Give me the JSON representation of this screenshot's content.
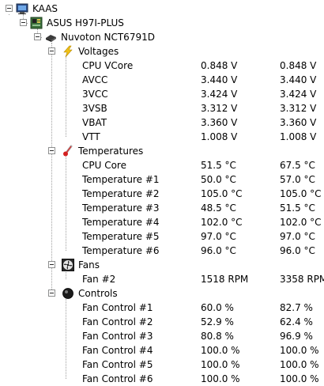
{
  "tree": {
    "computer": {
      "label": "KAAS",
      "icon": "computer-icon"
    },
    "board": {
      "label": "ASUS H97I-PLUS",
      "icon": "motherboard-icon"
    },
    "chip": {
      "label": "Nuvoton NCT6791D",
      "icon": "chip-icon"
    },
    "voltages": {
      "label": "Voltages",
      "icon": "lightning-icon",
      "items": [
        {
          "name": "CPU VCore",
          "value": "0.848 V",
          "max": "0.848 V"
        },
        {
          "name": "AVCC",
          "value": "3.440 V",
          "max": "3.440 V"
        },
        {
          "name": "3VCC",
          "value": "3.424 V",
          "max": "3.424 V"
        },
        {
          "name": "3VSB",
          "value": "3.312 V",
          "max": "3.312 V"
        },
        {
          "name": "VBAT",
          "value": "3.360 V",
          "max": "3.360 V"
        },
        {
          "name": "VTT",
          "value": "1.008 V",
          "max": "1.008 V"
        }
      ]
    },
    "temperatures": {
      "label": "Temperatures",
      "icon": "thermometer-icon",
      "items": [
        {
          "name": "CPU Core",
          "value": "51.5 °C",
          "max": "67.5 °C"
        },
        {
          "name": "Temperature #1",
          "value": "50.0 °C",
          "max": "57.0 °C"
        },
        {
          "name": "Temperature #2",
          "value": "105.0 °C",
          "max": "105.0 °C"
        },
        {
          "name": "Temperature #3",
          "value": "48.5 °C",
          "max": "51.5 °C"
        },
        {
          "name": "Temperature #4",
          "value": "102.0 °C",
          "max": "102.0 °C"
        },
        {
          "name": "Temperature #5",
          "value": "97.0 °C",
          "max": "97.0 °C"
        },
        {
          "name": "Temperature #6",
          "value": "96.0 °C",
          "max": "96.0 °C"
        }
      ]
    },
    "fans": {
      "label": "Fans",
      "icon": "fan-icon",
      "items": [
        {
          "name": "Fan #2",
          "value": "1518 RPM",
          "max": "3358 RPM"
        }
      ]
    },
    "controls": {
      "label": "Controls",
      "icon": "control-knob-icon",
      "items": [
        {
          "name": "Fan Control #1",
          "value": "60.0 %",
          "max": "82.7 %"
        },
        {
          "name": "Fan Control #2",
          "value": "52.9 %",
          "max": "62.4 %"
        },
        {
          "name": "Fan Control #3",
          "value": "80.8 %",
          "max": "96.9 %"
        },
        {
          "name": "Fan Control #4",
          "value": "100.0 %",
          "max": "100.0 %"
        },
        {
          "name": "Fan Control #5",
          "value": "100.0 %",
          "max": "100.0 %"
        },
        {
          "name": "Fan Control #6",
          "value": "100.0 %",
          "max": "100.0 %"
        }
      ]
    }
  }
}
